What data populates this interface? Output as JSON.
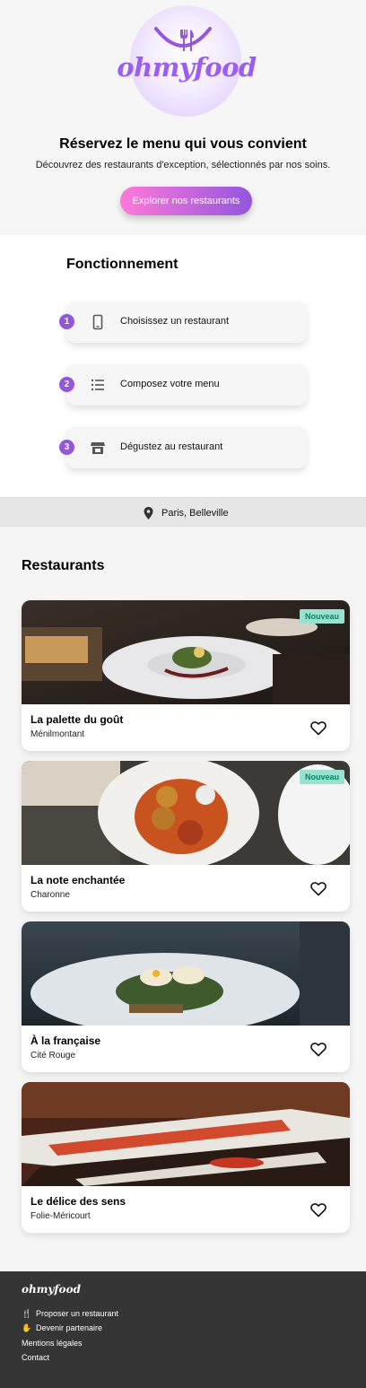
{
  "brand": {
    "name": "ohmyfood",
    "color": "#9356dc"
  },
  "hero": {
    "title": "Réservez le menu qui vous convient",
    "subtitle": "Découvrez des restaurants d'exception, sélectionnés par nos soins.",
    "cta_label": "Explorer nos restaurants"
  },
  "how": {
    "title": "Fonctionnement",
    "steps": [
      {
        "number": "1",
        "icon": "phone-icon",
        "label": "Choisissez un restaurant"
      },
      {
        "number": "2",
        "icon": "list-icon",
        "label": "Composez votre menu"
      },
      {
        "number": "3",
        "icon": "store-icon",
        "label": "Dégustez au restaurant"
      }
    ]
  },
  "location": {
    "icon": "map-pin-icon",
    "label": "Paris, Belleville"
  },
  "restaurants": {
    "title": "Restaurants",
    "items": [
      {
        "name": "La palette du goût",
        "area": "Ménilmontant",
        "badge": "Nouveau"
      },
      {
        "name": "La note enchantée",
        "area": "Charonne",
        "badge": "Nouveau"
      },
      {
        "name": "À la française",
        "area": "Cité Rouge"
      },
      {
        "name": "Le délice des sens",
        "area": "Folie-Méricourt"
      }
    ]
  },
  "footer": {
    "logo": "ohmyfood",
    "links": [
      {
        "label": "Proposer un restaurant",
        "icon": "utensils-icon"
      },
      {
        "label": "Devenir partenaire",
        "icon": "handshake-icon"
      },
      {
        "label": "Mentions légales"
      },
      {
        "label": "Contact"
      }
    ]
  }
}
